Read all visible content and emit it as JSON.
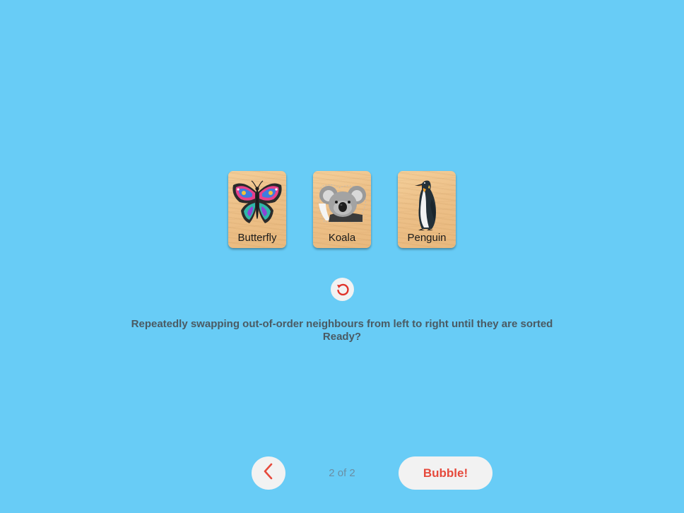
{
  "cards": [
    {
      "label": "Butterfly",
      "icon": "butterfly-icon"
    },
    {
      "label": "Koala",
      "icon": "koala-icon"
    },
    {
      "label": "Penguin",
      "icon": "penguin-icon"
    }
  ],
  "controls": {
    "reset_icon": "reset-icon",
    "back_icon": "chevron-left-icon",
    "page_indicator": "2 of 2",
    "primary_label": "Bubble!"
  },
  "instructions": {
    "line1": "Repeatedly swapping out-of-order neighbours from left to right until they are sorted",
    "line2": "Ready?"
  },
  "colors": {
    "background": "#68ccf6",
    "accent": "#e64a3c",
    "button_bg": "#f2f2f2",
    "text": "#4a5a63"
  }
}
